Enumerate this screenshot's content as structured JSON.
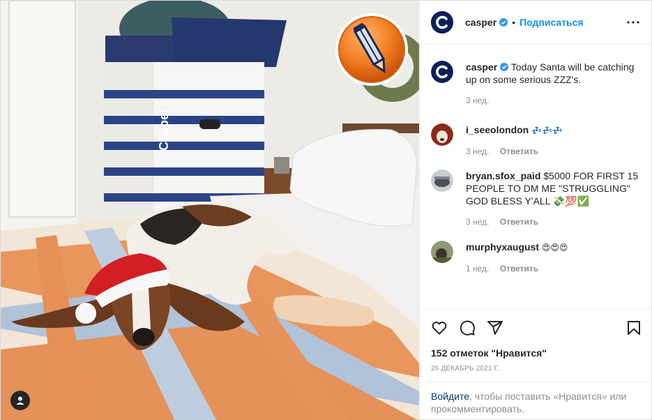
{
  "post": {
    "author": "casper",
    "follow_label": "Подписаться",
    "dot_separator": "•",
    "caption": {
      "username": "casper",
      "text": "Today Santa will be catching up on some serious ZZZ's.",
      "time": "3 нед."
    },
    "comments": [
      {
        "username": "i_seeolondon",
        "text": "💤💤💤",
        "time": "3 нед.",
        "reply_label": "Ответить",
        "avatar_color": "#8a2a1a"
      },
      {
        "username": "bryan.sfox_paid",
        "text": "$5000 FOR FIRST 15 PEOPLE TO DM ME \"STRUGGLING\" GOD BLESS Y'ALL 💸💯✅",
        "time": "3 нед.",
        "reply_label": "Ответить",
        "avatar_color": "#4a4f55"
      },
      {
        "username": "murphyxaugust",
        "text": "😍😍😍",
        "time": "1 нед.",
        "reply_label": "Ответить",
        "avatar_color": "#5b5a3c"
      }
    ],
    "likes_text": "152 отметок \"Нравится\"",
    "date": "26 ДЕКАБРЬ 2021 Г.",
    "login_prompt": {
      "link": "Войдите",
      "rest": ", чтобы поставить «Нравится» или прокомментировать."
    }
  },
  "photo": {
    "box_brand": "Casper"
  },
  "icons": [
    "casper-logo-icon",
    "verified-icon",
    "more-icon",
    "heart-icon",
    "comment-icon",
    "share-icon",
    "bookmark-icon",
    "pencil-edit-icon",
    "user-tag-icon"
  ],
  "colors": {
    "accent": "#0095f6",
    "brand_navy": "#0e1f58",
    "verified": "#3897f0",
    "muted": "#8e8e8e",
    "link_dark": "#00376b",
    "badge_orange": "#f07a1e"
  }
}
